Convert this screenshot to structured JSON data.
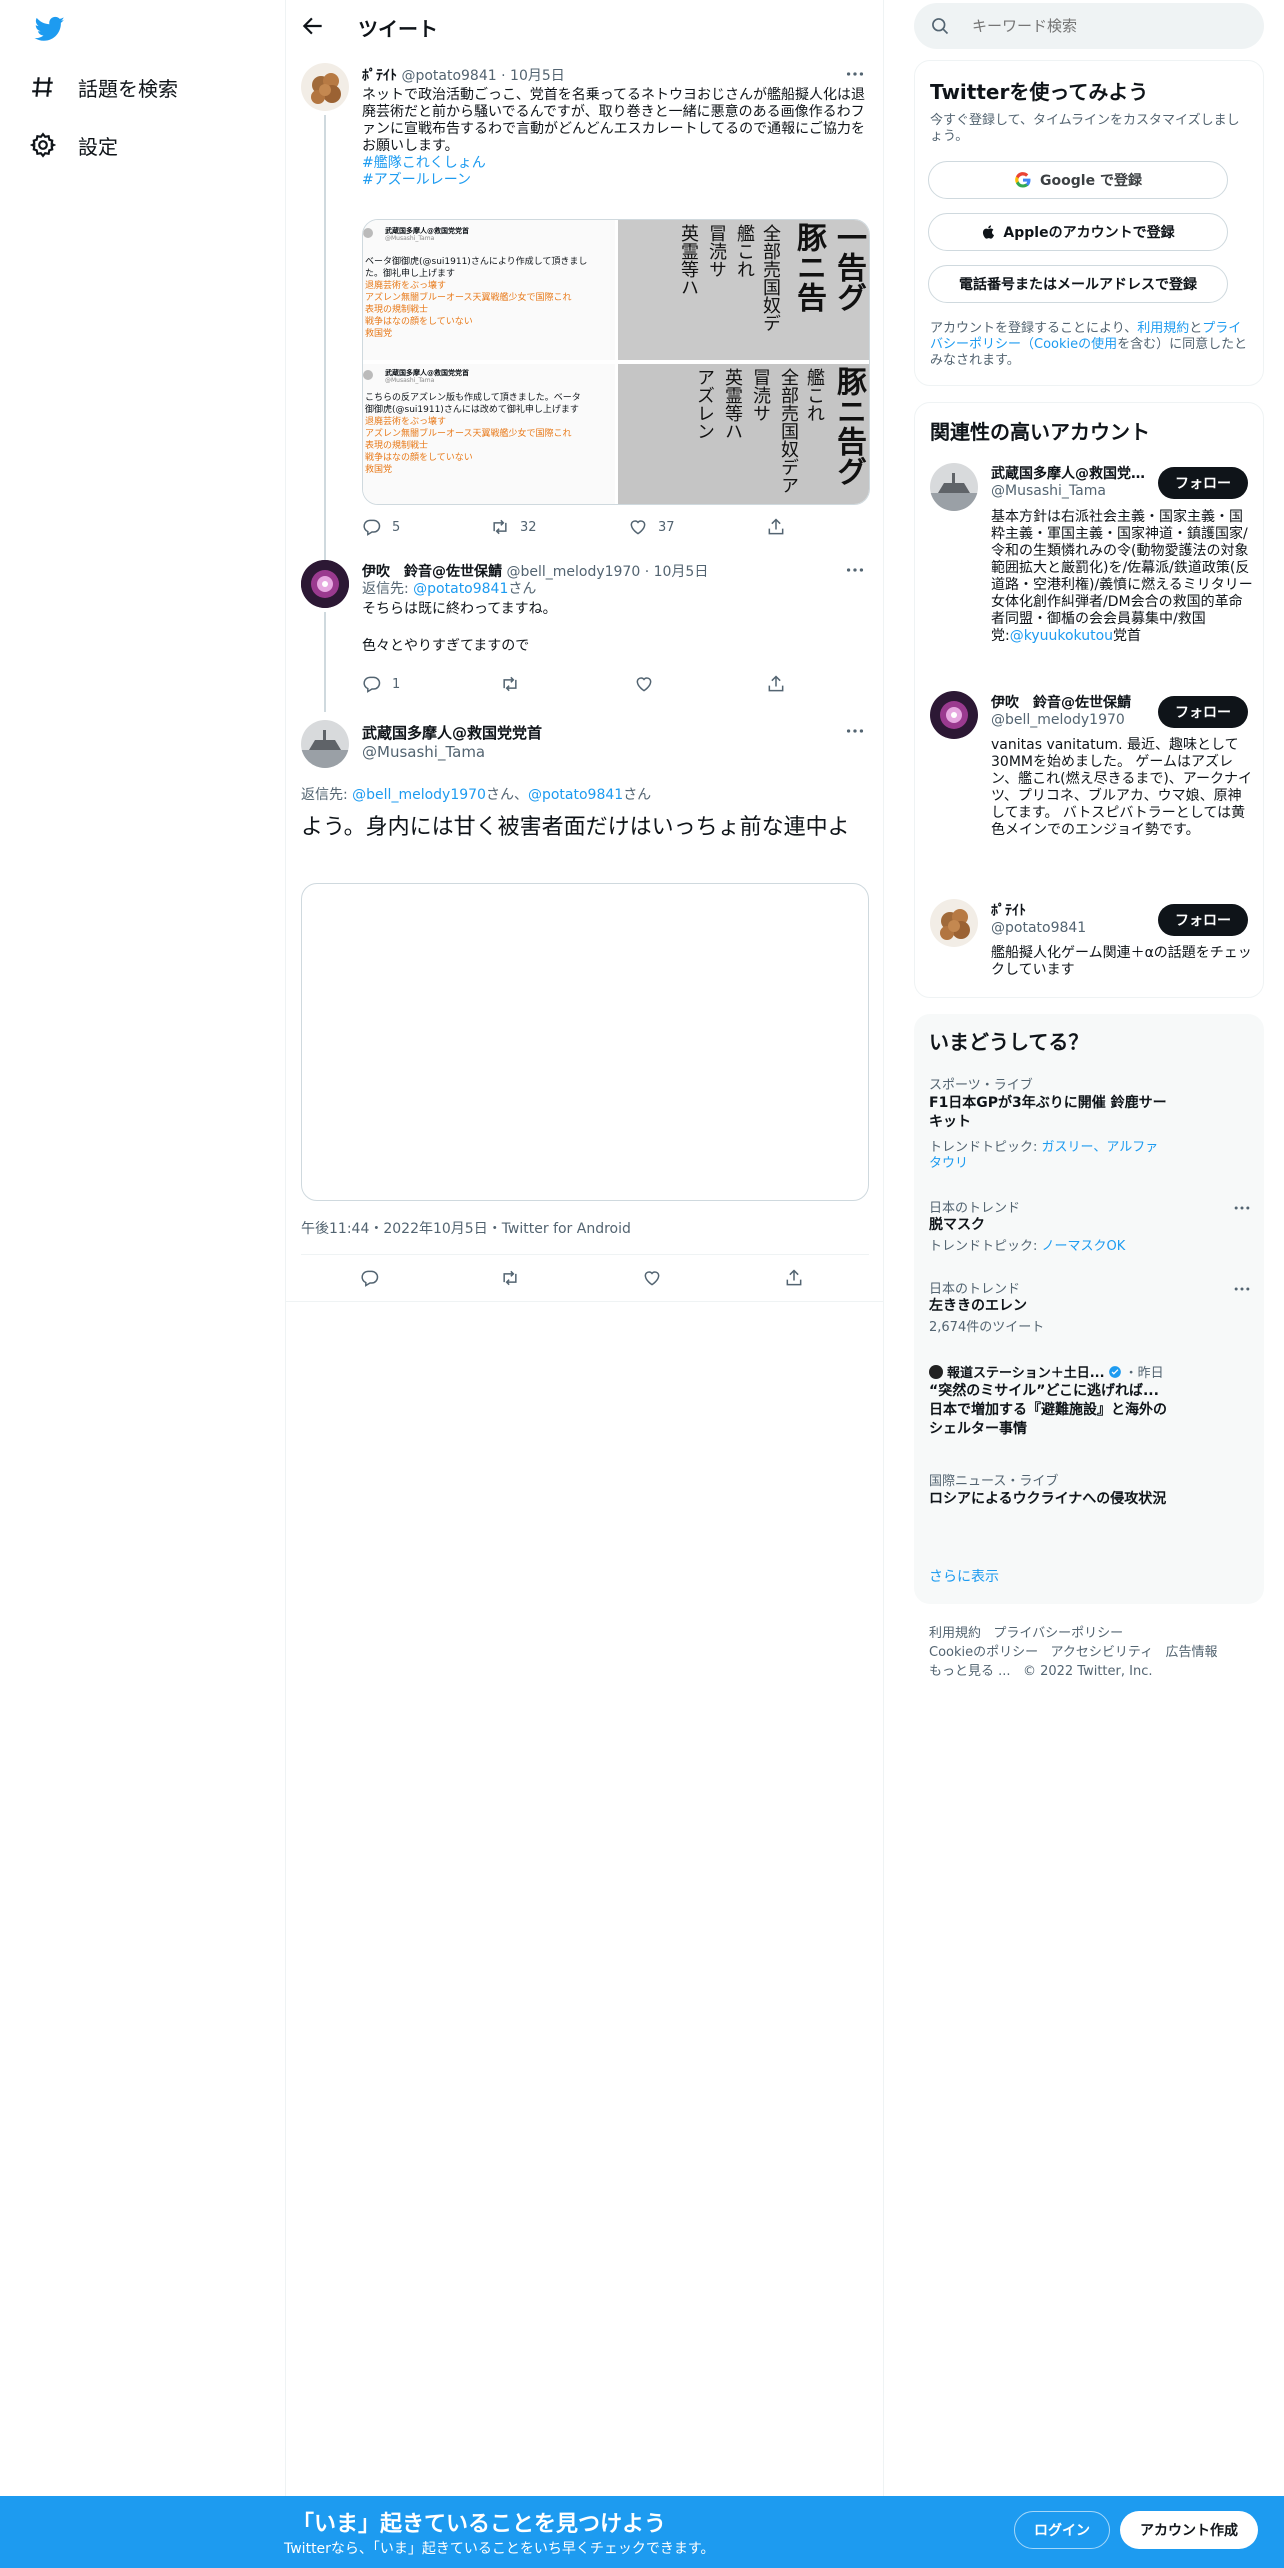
{
  "nav": {
    "explore_label": "話題を検索",
    "settings_label": "設定"
  },
  "header": {
    "title": "ツイート"
  },
  "thread": [
    {
      "name": "ﾎﾟﾃｲﾄ",
      "handle": "@potato9841",
      "date": "10月5日",
      "text": "ネットで政治活動ごっこ、党首を名乗ってるネトウヨおじさんが艦船擬人化は退廃芸術だと前から騒いでるんですが、取り巻きと一緒に悪意のある画像作るわファンに宣戦布告するわで言動がどんどんエスカレートしてるので通報にご協力をお願いします。",
      "hashtags": [
        "#艦隊これくしょん",
        "#アズールレーン"
      ],
      "media": {
        "top_left": {
          "name": "武蔵国多摩人@救国党党首",
          "handle": "@Musashi_Tama",
          "lines": [
            "ベータ御御虎(@sui1911)さんにより作成して頂きまし",
            "た。御礼申し上げます",
            "退廃芸術をぶっ壊す",
            "アズレン無闇ブルーオース天翼戦艦少女で国際これ",
            "表現の規制戦士",
            "戦争はなの顔をしていない",
            "救国党"
          ]
        },
        "bottom_left": {
          "name": "武蔵国多摩人@救国党党首",
          "handle": "@Musashi_Tama",
          "lines": [
            "こちらの反アズレン版も作成して頂きました。ベータ",
            "御御虎(@sui1911)さんには改めて御礼申し上げます",
            "退廃芸術をぶっ壊す",
            "アズレン無闇ブルーオース天翼戦艦少女で国際これ",
            "表現の規制戦士",
            "戦争はなの顔をしていない",
            "救国党"
          ]
        },
        "top_right": [
          "一告グ",
          "豚ニ告",
          "全部売国奴デ",
          "艦これ",
          "冒涜サ",
          "英霊等ハ"
        ],
        "bottom_right": [
          "豚ニ告グ",
          "艦これ",
          "全部売国奴デア",
          "冒涜サ",
          "英霊等ハ",
          "アズレン"
        ]
      },
      "replies": "5",
      "retweets": "32",
      "likes": "37"
    },
    {
      "name": "伊吹　鈴音@佐世保鯖",
      "handle": "@bell_melody1970",
      "date": "10月5日",
      "reply_prefix": "返信先: ",
      "reply_to": "@potato9841",
      "reply_suffix": "さん",
      "line1": "そちらは既に終わってますね。",
      "line2": "色々とやりすぎてますので",
      "replies": "1"
    }
  ],
  "focal": {
    "name": "武蔵国多摩人@救国党党首",
    "handle": "@Musashi_Tama",
    "reply_prefix": "返信先: ",
    "reply_to_1": "@bell_melody1970",
    "reply_mid": "さん、",
    "reply_to_2": "@potato9841",
    "reply_suffix": "さん",
    "text": "よう。身内には甘く被害者面だけはいっちょ前な連中よ",
    "meta": "午後11:44・2022年10月5日・Twitter for Android"
  },
  "search": {
    "placeholder": "キーワード検索"
  },
  "signup_card": {
    "title": "Twitterを使ってみよう",
    "subtitle": "今すぐ登録して、タイムラインをカスタマイズしましょう。",
    "google": "Google で登録",
    "apple": "Appleのアカウントで登録",
    "phone": "電話番号またはメールアドレスで登録",
    "legal_a": "アカウントを登録することにより、",
    "legal_terms": "利用規約",
    "legal_b": "と",
    "legal_privacy": "プライバシーポリシー（Cookieの使用",
    "legal_c": "を含む）に同意したとみなされます。"
  },
  "related": {
    "title": "関連性の高いアカウント",
    "follow": "フォロー",
    "accounts": [
      {
        "name": "武蔵国多摩人@救国党党首",
        "handle": "@Musashi_Tama",
        "bio": "基本方針は右派社会主義・国家主義・国粋主義・軍国主義・国家神道・鎮護国家/令和の生類憐れみの令(動物愛護法の対象範囲拡大と厳罰化)を/佐幕派/鉄道政策(反道路・空港利権)/義憤に燃えるミリタリー女体化創作糾弾者/DM会合の救国的革命者同盟・御楯の会会員募集中/救国党:",
        "bio_link": "@kyuukokutou",
        "bio_end": "党首"
      },
      {
        "name": "伊吹　鈴音@佐世保鯖",
        "handle": "@bell_melody1970",
        "bio": "vanitas vanitatum. 最近、趣味として30MMを始めました。 ゲームはアズレン、艦これ(燃え尽きるまで)、アークナイツ、プリコネ、ブルアカ、ウマ娘、原神してます。 バトスピバトラーとしては黄色メインでのエンジョイ勢です。"
      },
      {
        "name": "ﾎﾟﾃｲﾄ",
        "handle": "@potato9841",
        "bio": "艦船擬人化ゲーム関連＋αの話題をチェックしています"
      }
    ]
  },
  "trends": {
    "title": "いまどうしてる？",
    "items": [
      {
        "meta": "スポーツ・ライブ",
        "name": "F1日本GPが3年ぶりに開催 鈴鹿サーキット",
        "sub_prefix": "トレンドトピック: ",
        "sub_link": "ガスリー、アルファタウリ"
      },
      {
        "meta": "日本のトレンド",
        "name": "脱マスク",
        "sub_prefix": "トレンドトピック: ",
        "sub_link": "ノーマスクOK"
      },
      {
        "meta": "日本のトレンド",
        "name": "左ききのエレン",
        "sub": "2,674件のツイート"
      },
      {
        "source": "報道ステーション＋土日...",
        "time": "・昨日",
        "name": "“突然のミサイル”どこに逃げれば... 日本で増加する『避難施設』と海外のシェルター事情"
      },
      {
        "meta": "国際ニュース・ライブ",
        "name": "ロシアによるウクライナへの侵攻状況"
      }
    ],
    "show_more": "さらに表示"
  },
  "footer": {
    "terms": "利用規約",
    "privacy": "プライバシーポリシー",
    "cookie": "Cookieのポリシー",
    "a11y": "アクセシビリティ",
    "ads": "広告情報",
    "more": "もっと見る ...",
    "copyright": "© 2022 Twitter, Inc."
  },
  "bottom_bar": {
    "title": "「いま」起きていることを見つけよう",
    "subtitle": "Twitterなら、「いま」起きていることをいち早くチェックできます。",
    "login": "ログイン",
    "signup": "アカウント作成"
  },
  "colors": {
    "accent": "#1d9bf0",
    "text": "#0f1419",
    "muted": "#536471",
    "border": "#eff3f4"
  }
}
